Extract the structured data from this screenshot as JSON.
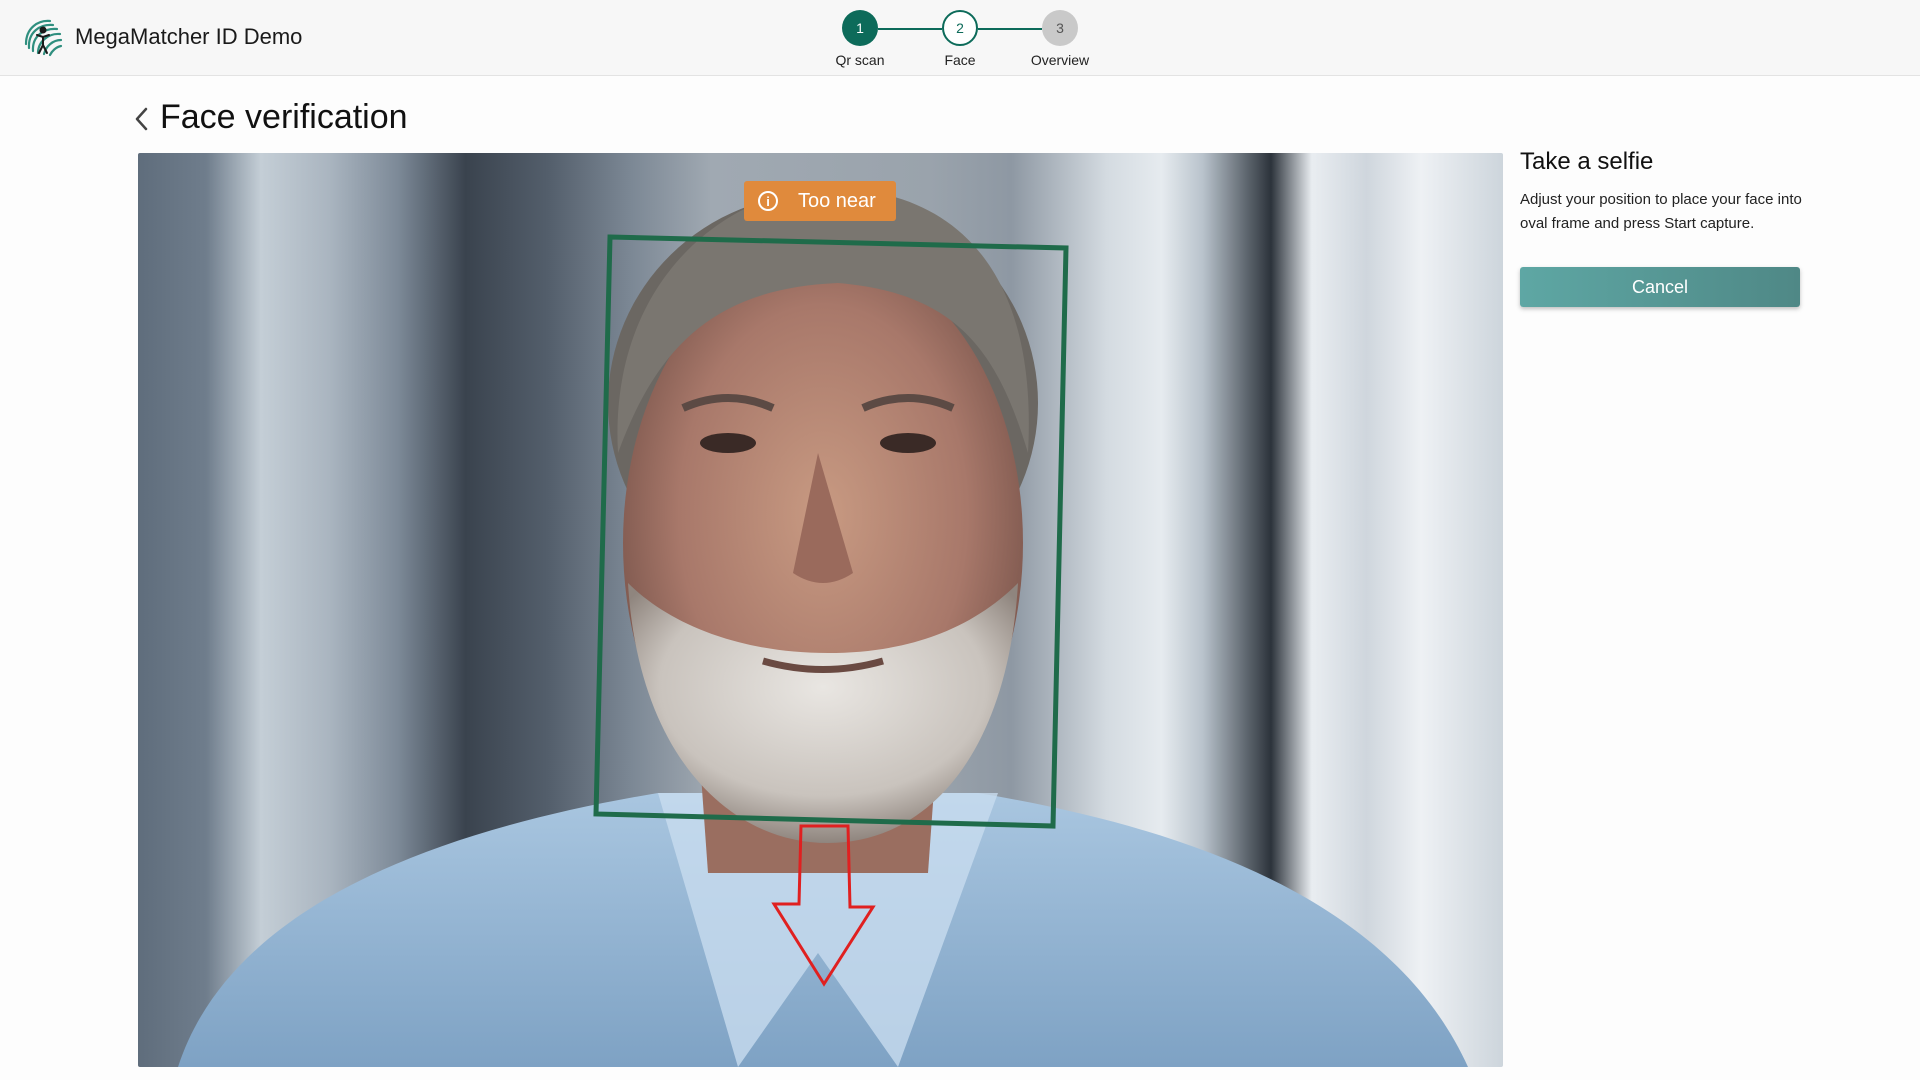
{
  "header": {
    "app_title": "MegaMatcher ID Demo",
    "logo_icon": "fingerprint-person-logo"
  },
  "stepper": {
    "steps": [
      {
        "number": "1",
        "label": "Qr scan",
        "state": "done"
      },
      {
        "number": "2",
        "label": "Face",
        "state": "active"
      },
      {
        "number": "3",
        "label": "Overview",
        "state": "todo"
      }
    ]
  },
  "page": {
    "title": "Face verification",
    "back_icon": "chevron-left-icon"
  },
  "camera": {
    "status_text": "Too near",
    "status_icon": "info-icon",
    "status_color": "#e08a3c",
    "face_frame_color": "#1f6b4a",
    "arrow_color": "#e02020",
    "arrow_direction": "down"
  },
  "panel": {
    "title": "Take a selfie",
    "instructions": "Adjust your position to place your face into oval frame and press Start capture.",
    "cancel_label": "Cancel"
  },
  "colors": {
    "accent": "#0d6b5a",
    "button": "#5a9e9c"
  }
}
